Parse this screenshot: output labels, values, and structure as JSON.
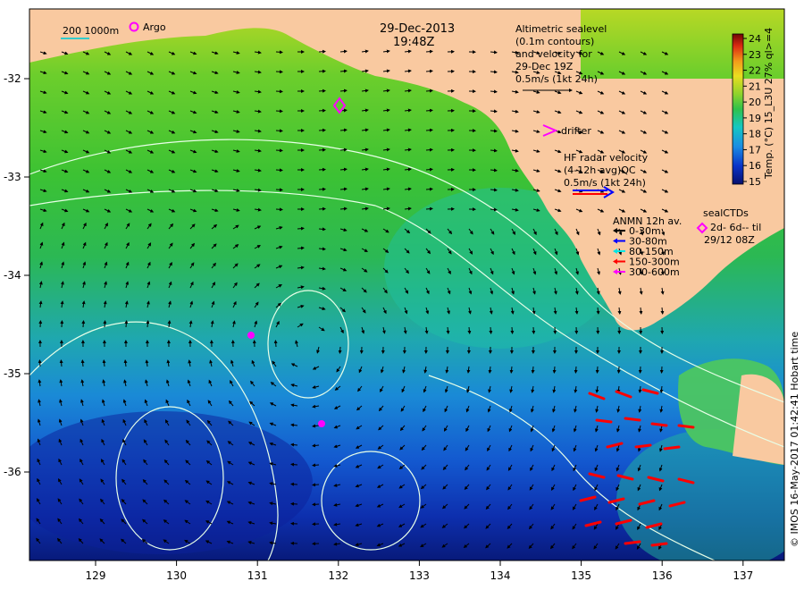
{
  "map": {
    "date_label": "29-Dec-2013",
    "time_label": "19:48Z",
    "x_ticks": [
      "129",
      "130",
      "131",
      "132",
      "133",
      "134",
      "135",
      "136",
      "137"
    ],
    "y_ticks": [
      "-32",
      "-33",
      "-34",
      "-35",
      "-36"
    ]
  },
  "legend": {
    "contour_label": "200  1000m",
    "argo_label": "Argo",
    "altimetry": [
      "Altimetric sealevel",
      "(0.1m contours)",
      "and velocity for",
      "29-Dec 19Z",
      "0.5m/s (1kt 24h)"
    ],
    "drifter_label": "drifter",
    "hf_radar": [
      "HF radar velocity",
      "(4-12h avg)QC",
      "0.5m/s (1kt 24h)"
    ],
    "anmn": {
      "title": "ANMN 12h av.",
      "items": [
        {
          "label": "0-30m",
          "color": "#000000"
        },
        {
          "label": "30-80m",
          "color": "#0000ff"
        },
        {
          "label": "80-150m",
          "color": "#00e5e5"
        },
        {
          "label": "150-300m",
          "color": "#ff0000"
        },
        {
          "label": "300-600m",
          "color": "#ff00ff"
        }
      ]
    },
    "sealctd": [
      "sealCTDs",
      "2d- 6d-- til",
      "29/12 08Z"
    ]
  },
  "colorbar": {
    "ticks": [
      "15",
      "16",
      "17",
      "18",
      "19",
      "20",
      "21",
      "22",
      "23",
      "24"
    ],
    "title": "Temp. (°C) 15_L3U 27% ql>=4"
  },
  "credit": "© IMOS 16-May-2017 01:42:41 Hobart time",
  "colors": {
    "land": "#f9c9a0",
    "argo": "#ff00ff",
    "radar": "#ff0000",
    "contour": "#e8ffe8"
  }
}
